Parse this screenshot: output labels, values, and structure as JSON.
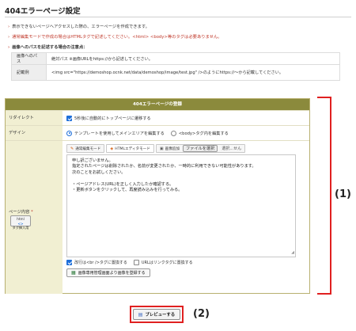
{
  "page": {
    "title": "404エラーページ設定"
  },
  "notes": {
    "mark": "›",
    "line1": "表示できないページへアクセスした際の、エラーページを作成できます。",
    "line2": "通常編集モードで作成の場合はHTMLタグで記述してください。<html> <body>等のタグは必要ありません。",
    "line3": "画像へのパスを記述する場合の注意点："
  },
  "path_table": {
    "rows": [
      {
        "label": "画像へのパス",
        "value": "絶対パス ※画像URLをhttps://から記述してください。"
      },
      {
        "label": "記載例",
        "value": "<img src=\"https://demoshop.ocnk.net/data/demoshop/image/test.jpg\" />のようにhttps://〜から記載してください。"
      }
    ]
  },
  "panel": {
    "header": "404エラーページの登録",
    "redirect": {
      "label": "リダイレクト",
      "checkbox_label": "5秒後に自動的にトップページに遷移する",
      "checked": true
    },
    "design": {
      "label": "デザイン",
      "option1": "テンプレートを使用してメインエリアを編集する",
      "option2": "<body>タグ内を編集する",
      "selected": "option1"
    },
    "content": {
      "label": "ページ内容",
      "required_mark": "*",
      "html_button_line1": "html",
      "html_button_sym": "<>",
      "html_button_line2": "タグ挿入用",
      "tabs": [
        "通常編集モード",
        "HTMLエディタモード",
        "画像追加"
      ],
      "file_button": "ファイルを選択",
      "file_status": "選択...せん",
      "editor_lines": [
        "申し訳ございません。",
        "指定されたページは削除されたか、名前が変更されたか、一時的に利用できない可能性があります。",
        "次のことをお試しください。",
        "",
        "・ページアドレス(URL)を正しく入力したか確認する。",
        "・更新ボタンをクリックして、再度読み込みを行ってみる。"
      ],
      "opt1_label": "改行は<br />タグに置換する",
      "opt1_checked": true,
      "opt2_label": "URLはリンクタグに置換する",
      "opt2_checked": false,
      "image_button": "画像専用管理画面より画像を登録する"
    }
  },
  "preview_button": "プレビューする",
  "annotations": {
    "label1": "(1)",
    "label2": "(2)"
  },
  "colors": {
    "panel_header": "#8b8a3c",
    "label_bg": "#f1efd2",
    "annotation_red": "#e02020",
    "accent_blue": "#1e6fd9"
  }
}
